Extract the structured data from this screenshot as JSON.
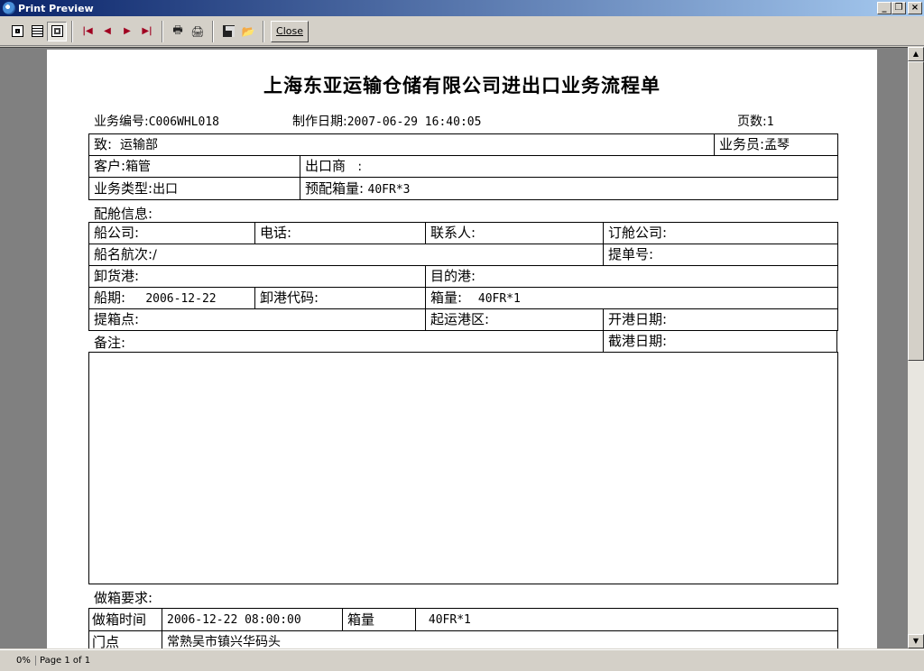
{
  "window": {
    "title": "Print Preview",
    "min": "_",
    "restore": "❐",
    "close": "×"
  },
  "toolbar": {
    "close_label": "Close"
  },
  "status": {
    "zoom": "0%",
    "page": "Page 1 of 1"
  },
  "doc": {
    "title": "上海东亚运输仓储有限公司进出口业务流程单",
    "job_no_label": "业务编号:",
    "job_no": "C006WHL018",
    "date_label": "制作日期:",
    "date": "2007-06-29 16:40:05",
    "pages_label": "页数:",
    "pages": "1",
    "to_label": "致:",
    "to": "运输部",
    "staff_label": "业务员:",
    "staff": "孟琴",
    "client_label": "客户:",
    "client": "箱管",
    "exporter_label": "出口商",
    "exporter": ":",
    "biz_type_label": "业务类型:",
    "biz_type": "出口",
    "prebook_label": "预配箱量:",
    "prebook": "40FR*3",
    "booking_info_label": "配舱信息:",
    "carrier_label": "船公司:",
    "phone_label": "电话:",
    "contact_label": "联系人:",
    "book_co_label": "订舱公司:",
    "vessel_label": "船名航次:",
    "vessel": "/",
    "bl_label": "提单号:",
    "pod_label": "卸货港:",
    "dest_label": "目的港:",
    "etd_label": "船期:",
    "etd": "2006-12-22",
    "pod_code_label": "卸港代码:",
    "qty_label": "箱量:",
    "qty": "40FR*1",
    "pickup_label": "提箱点:",
    "origin_label": "起运港区:",
    "open_label": "开港日期:",
    "remarks_label": "备注:",
    "cutoff_label": "截港日期:",
    "req_label": "做箱要求:",
    "stuff_time_label": "做箱时间",
    "stuff_time": "2006-12-22 08:00:00",
    "stuff_qty_label": "箱量",
    "stuff_qty": "40FR*1",
    "door_label": "门点",
    "door": "常熟吴市镇兴华码头"
  }
}
